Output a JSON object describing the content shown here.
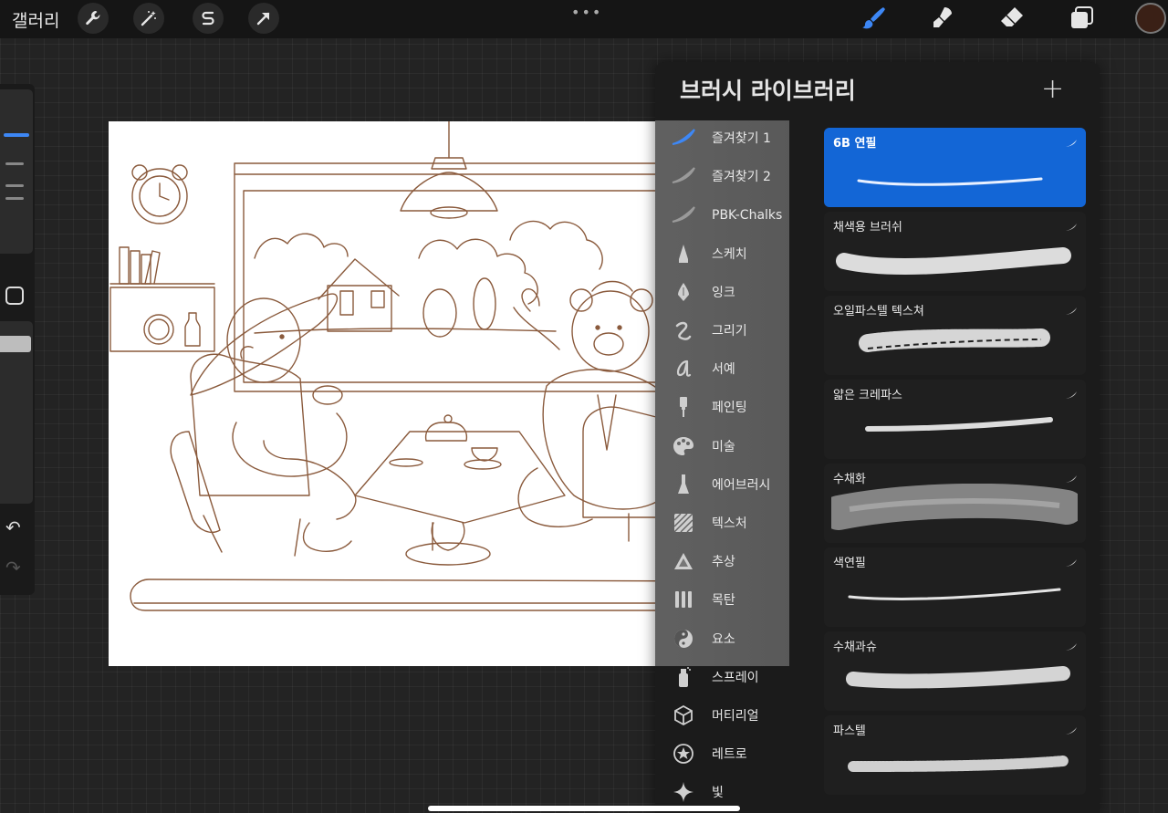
{
  "topbar": {
    "gallery_label": "갤러리",
    "tools_left": [
      "wrench-icon",
      "magic-wand-icon",
      "selection-s-icon",
      "transform-arrow-icon"
    ],
    "more": "•••",
    "tools_right": [
      "brush-icon",
      "smudge-icon",
      "eraser-icon",
      "layers-icon"
    ],
    "active_tool": "brush-icon",
    "current_color": "#3a2016"
  },
  "sidebar": {
    "undo": "↶",
    "redo": "↷"
  },
  "library": {
    "title": "브러시 라이브러리",
    "add": "+",
    "sets": [
      {
        "label": "즐겨찾기 1",
        "icon": "favorite-stroke-icon",
        "active": true
      },
      {
        "label": "즐겨찾기 2",
        "icon": "favorite-stroke-icon",
        "active": false
      },
      {
        "label": "PBK-Chalks",
        "icon": "favorite-stroke-icon",
        "active": false
      },
      {
        "label": "스케치",
        "icon": "pencil-tip-icon",
        "active": false
      },
      {
        "label": "잉크",
        "icon": "pen-nib-icon",
        "active": false
      },
      {
        "label": "그리기",
        "icon": "squiggle-icon",
        "active": false
      },
      {
        "label": "서예",
        "icon": "calligraphy-icon",
        "active": false
      },
      {
        "label": "페인팅",
        "icon": "paint-brush-icon",
        "active": false
      },
      {
        "label": "미술",
        "icon": "palette-icon",
        "active": false
      },
      {
        "label": "에어브러시",
        "icon": "airbrush-icon",
        "active": false
      },
      {
        "label": "텍스처",
        "icon": "texture-icon",
        "active": false
      },
      {
        "label": "추상",
        "icon": "triangle-icon",
        "active": false
      },
      {
        "label": "목탄",
        "icon": "charcoal-icon",
        "active": false
      },
      {
        "label": "요소",
        "icon": "yin-yang-icon",
        "active": false
      },
      {
        "label": "스프레이",
        "icon": "spray-can-icon",
        "active": false
      },
      {
        "label": "머티리얼",
        "icon": "cube-icon",
        "active": false
      },
      {
        "label": "레트로",
        "icon": "star-circle-icon",
        "active": false
      },
      {
        "label": "빛",
        "icon": "sparkle-icon",
        "active": false
      }
    ],
    "brushes": [
      {
        "name": "6B 연필",
        "selected": true
      },
      {
        "name": "채색용 브러쉬",
        "selected": false
      },
      {
        "name": "오일파스텔 텍스쳐",
        "selected": false
      },
      {
        "name": "얇은 크레파스",
        "selected": false
      },
      {
        "name": "수채화",
        "selected": false
      },
      {
        "name": "색연필",
        "selected": false
      },
      {
        "name": "수채과슈",
        "selected": false
      },
      {
        "name": "파스텔",
        "selected": false
      }
    ]
  }
}
